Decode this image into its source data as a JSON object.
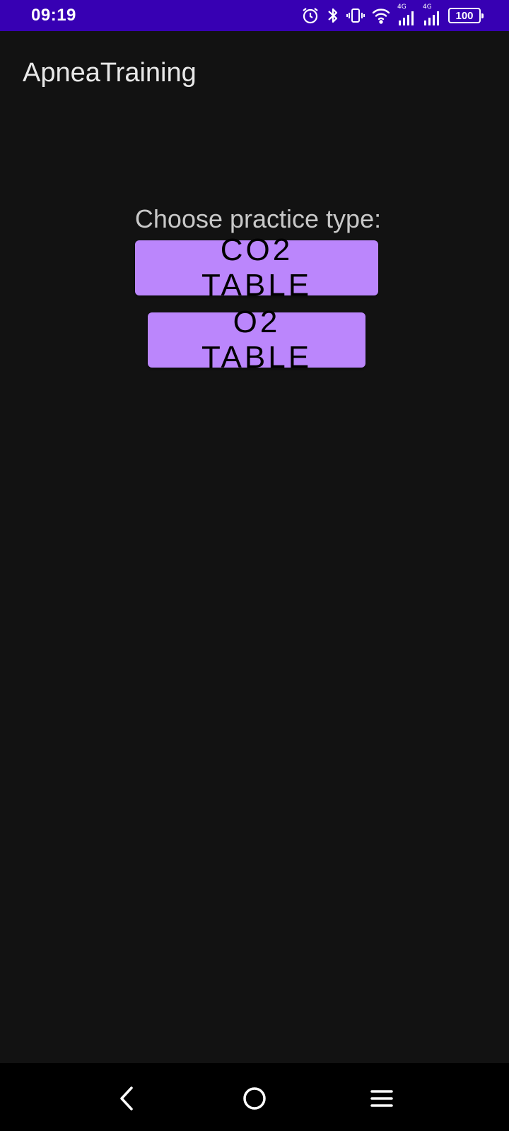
{
  "status_bar": {
    "time": "09:19",
    "icons": [
      "alarm-icon",
      "bluetooth-icon",
      "vibrate-icon",
      "wifi-icon",
      "signal-4g-icon",
      "signal-4g-icon",
      "battery-icon"
    ],
    "signal_1_tag": "4G",
    "signal_2_tag": "4G",
    "battery": "100",
    "background": "#3700b3"
  },
  "app_bar": {
    "title": "ApneaTraining"
  },
  "main": {
    "prompt": "Choose practice type:",
    "buttons": [
      {
        "label": "CO2 TABLE"
      },
      {
        "label": "O2 TABLE"
      }
    ],
    "button_color": "#bb86fc",
    "background": "#121212"
  },
  "nav_bar": {
    "items": [
      "back-icon",
      "home-icon",
      "menu-icon"
    ]
  }
}
